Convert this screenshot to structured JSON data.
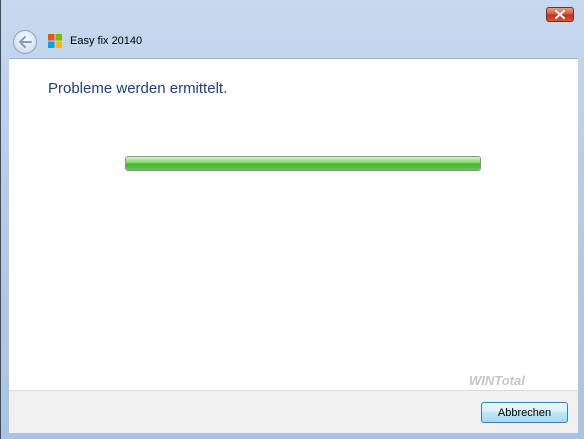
{
  "window": {
    "title": "Easy fix 20140",
    "close_icon": "close-icon",
    "back_icon": "back-arrow-icon",
    "logo_icon": "windows-logo-icon"
  },
  "main": {
    "heading": "Probleme werden ermittelt.",
    "progress": {
      "value_fraction": 1.0,
      "color": "#3fb529"
    }
  },
  "footer": {
    "watermark": "WINTotal",
    "cancel_label": "Abbrechen"
  },
  "colors": {
    "heading": "#1e3e8a",
    "frame": "#b7cde8",
    "close": "#c0311b"
  }
}
